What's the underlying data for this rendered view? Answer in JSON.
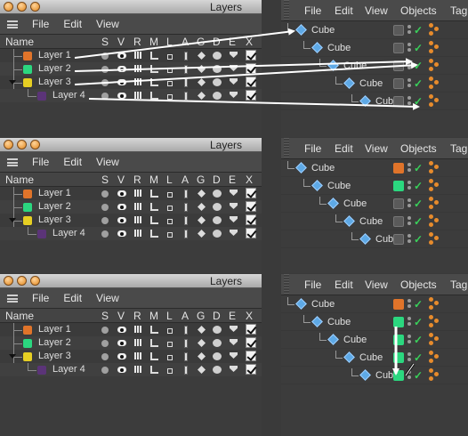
{
  "colors": {
    "layer1": "#e0742a",
    "layer2": "#2bd77f",
    "layer3": "#e6cf23",
    "layer4": "#5b3478",
    "check": "#39d05a"
  },
  "panels": [
    {
      "layers": {
        "title": "Layers",
        "menu": [
          "File",
          "Edit",
          "View"
        ],
        "header": {
          "name": "Name",
          "cols": [
            "S",
            "V",
            "R",
            "M",
            "L",
            "A",
            "G",
            "D",
            "E",
            "X"
          ]
        },
        "rows": [
          "Layer 1",
          "Layer 2",
          "Layer 3",
          "Layer 4"
        ]
      },
      "objects": {
        "menu": [
          "File",
          "Edit",
          "View",
          "Objects",
          "Tag"
        ],
        "rows": [
          "Cube",
          "Cube",
          "Cube",
          "Cube",
          "Cube"
        ]
      }
    },
    {
      "layers": {
        "title": "Layers",
        "menu": [
          "File",
          "Edit",
          "View"
        ],
        "header": {
          "name": "Name",
          "cols": [
            "S",
            "V",
            "R",
            "M",
            "L",
            "A",
            "G",
            "D",
            "E",
            "X"
          ]
        },
        "rows": [
          "Layer 1",
          "Layer 2",
          "Layer 3",
          "Layer 4"
        ]
      },
      "objects": {
        "menu": [
          "File",
          "Edit",
          "View",
          "Objects",
          "Tag"
        ],
        "rows": [
          "Cube",
          "Cube",
          "Cube",
          "Cube",
          "Cube"
        ]
      }
    },
    {
      "layers": {
        "title": "Layers",
        "menu": [
          "File",
          "Edit",
          "View"
        ],
        "header": {
          "name": "Name",
          "cols": [
            "S",
            "V",
            "R",
            "M",
            "L",
            "A",
            "G",
            "D",
            "E",
            "X"
          ]
        },
        "rows": [
          "Layer 1",
          "Layer 2",
          "Layer 3",
          "Layer 4"
        ]
      },
      "objects": {
        "menu": [
          "File",
          "Edit",
          "View",
          "Objects",
          "Tag"
        ],
        "rows": [
          "Cube",
          "Cube",
          "Cube",
          "Cube",
          "Cube"
        ]
      }
    }
  ]
}
